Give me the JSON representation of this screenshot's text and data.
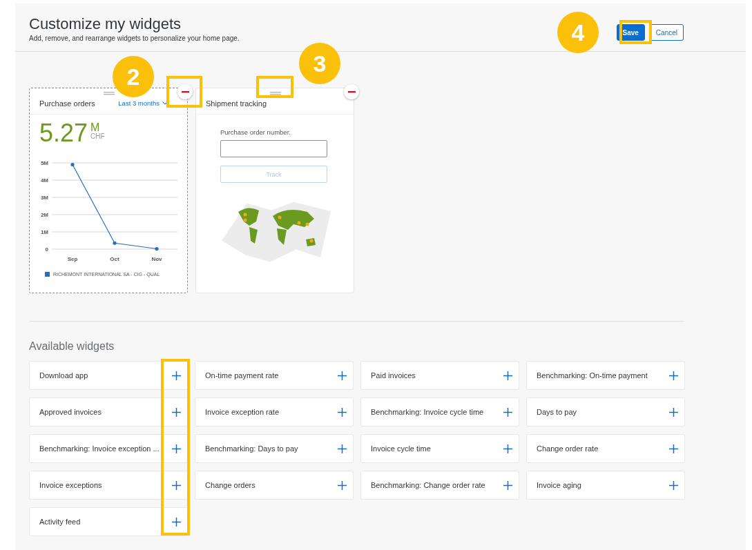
{
  "header": {
    "title": "Customize my widgets",
    "subtitle": "Add, remove, and rearrange widgets to personalize your home page.",
    "buttons": [
      {
        "label": "Save",
        "kind": "primary"
      },
      {
        "label": "Cancel",
        "kind": "secondary"
      }
    ]
  },
  "active_widgets": [
    {
      "kind": "purchase_orders",
      "title": "Purchase orders",
      "period": "Last 3 months",
      "value": "5.27",
      "unit": "M",
      "currency": "CHF",
      "chart_data": {
        "type": "line",
        "grid": true,
        "categories": [
          "Sep",
          "Oct",
          "Nov"
        ],
        "series": [
          {
            "name": "RICHEMONT INTERNATIONAL SA - CIG - QUAL",
            "color": "#2a6ebb",
            "values": [
              4.9,
              0.35,
              0.02
            ]
          }
        ],
        "ylim": [
          0,
          5
        ],
        "yticks": [
          {
            "value": 0,
            "label": "0"
          },
          {
            "value": 1,
            "label": "1M"
          },
          {
            "value": 2,
            "label": "2M"
          },
          {
            "value": 3,
            "label": "3M"
          },
          {
            "value": 4,
            "label": "4M"
          },
          {
            "value": 5,
            "label": "5M"
          }
        ]
      }
    },
    {
      "kind": "shipment",
      "title": "Shipment tracking",
      "field_label": "Purchase order number.",
      "button": "Track",
      "button_disabled": true
    }
  ],
  "available_title": "Available widgets",
  "available_widgets": [
    "Download app",
    "On-time payment rate",
    "Paid invoices",
    "Benchmarking: On-time payment",
    "Approved invoices",
    "Invoice exception rate",
    "Benchmarking: Invoice cycle time",
    "Days to pay",
    "Benchmarking: Invoice exception ...",
    "Benchmarking: Days to pay",
    "Invoice cycle time",
    "Change order rate",
    "Invoice exceptions",
    "Change orders",
    "Benchmarking: Change order rate",
    "Invoice aging",
    "Activity feed"
  ],
  "callouts": [
    "2",
    "3",
    "4"
  ]
}
